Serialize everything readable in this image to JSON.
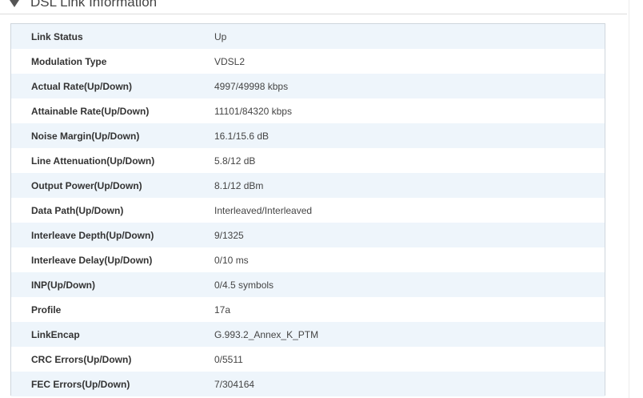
{
  "section": {
    "title": "DSL Link Information"
  },
  "rows": [
    {
      "label": "Link Status",
      "value": "Up"
    },
    {
      "label": "Modulation Type",
      "value": "VDSL2"
    },
    {
      "label": "Actual Rate(Up/Down)",
      "value": "4997/49998 kbps"
    },
    {
      "label": "Attainable Rate(Up/Down)",
      "value": "11101/84320 kbps"
    },
    {
      "label": "Noise Margin(Up/Down)",
      "value": "16.1/15.6 dB"
    },
    {
      "label": "Line Attenuation(Up/Down)",
      "value": "5.8/12 dB"
    },
    {
      "label": "Output Power(Up/Down)",
      "value": "8.1/12 dBm"
    },
    {
      "label": "Data Path(Up/Down)",
      "value": "Interleaved/Interleaved"
    },
    {
      "label": "Interleave Depth(Up/Down)",
      "value": "9/1325"
    },
    {
      "label": "Interleave Delay(Up/Down)",
      "value": "0/10 ms"
    },
    {
      "label": "INP(Up/Down)",
      "value": "0/4.5 symbols"
    },
    {
      "label": "Profile",
      "value": "17a"
    },
    {
      "label": "LinkEncap",
      "value": "G.993.2_Annex_K_PTM"
    },
    {
      "label": "CRC Errors(Up/Down)",
      "value": "0/5511"
    },
    {
      "label": "FEC Errors(Up/Down)",
      "value": "7/304164"
    }
  ]
}
